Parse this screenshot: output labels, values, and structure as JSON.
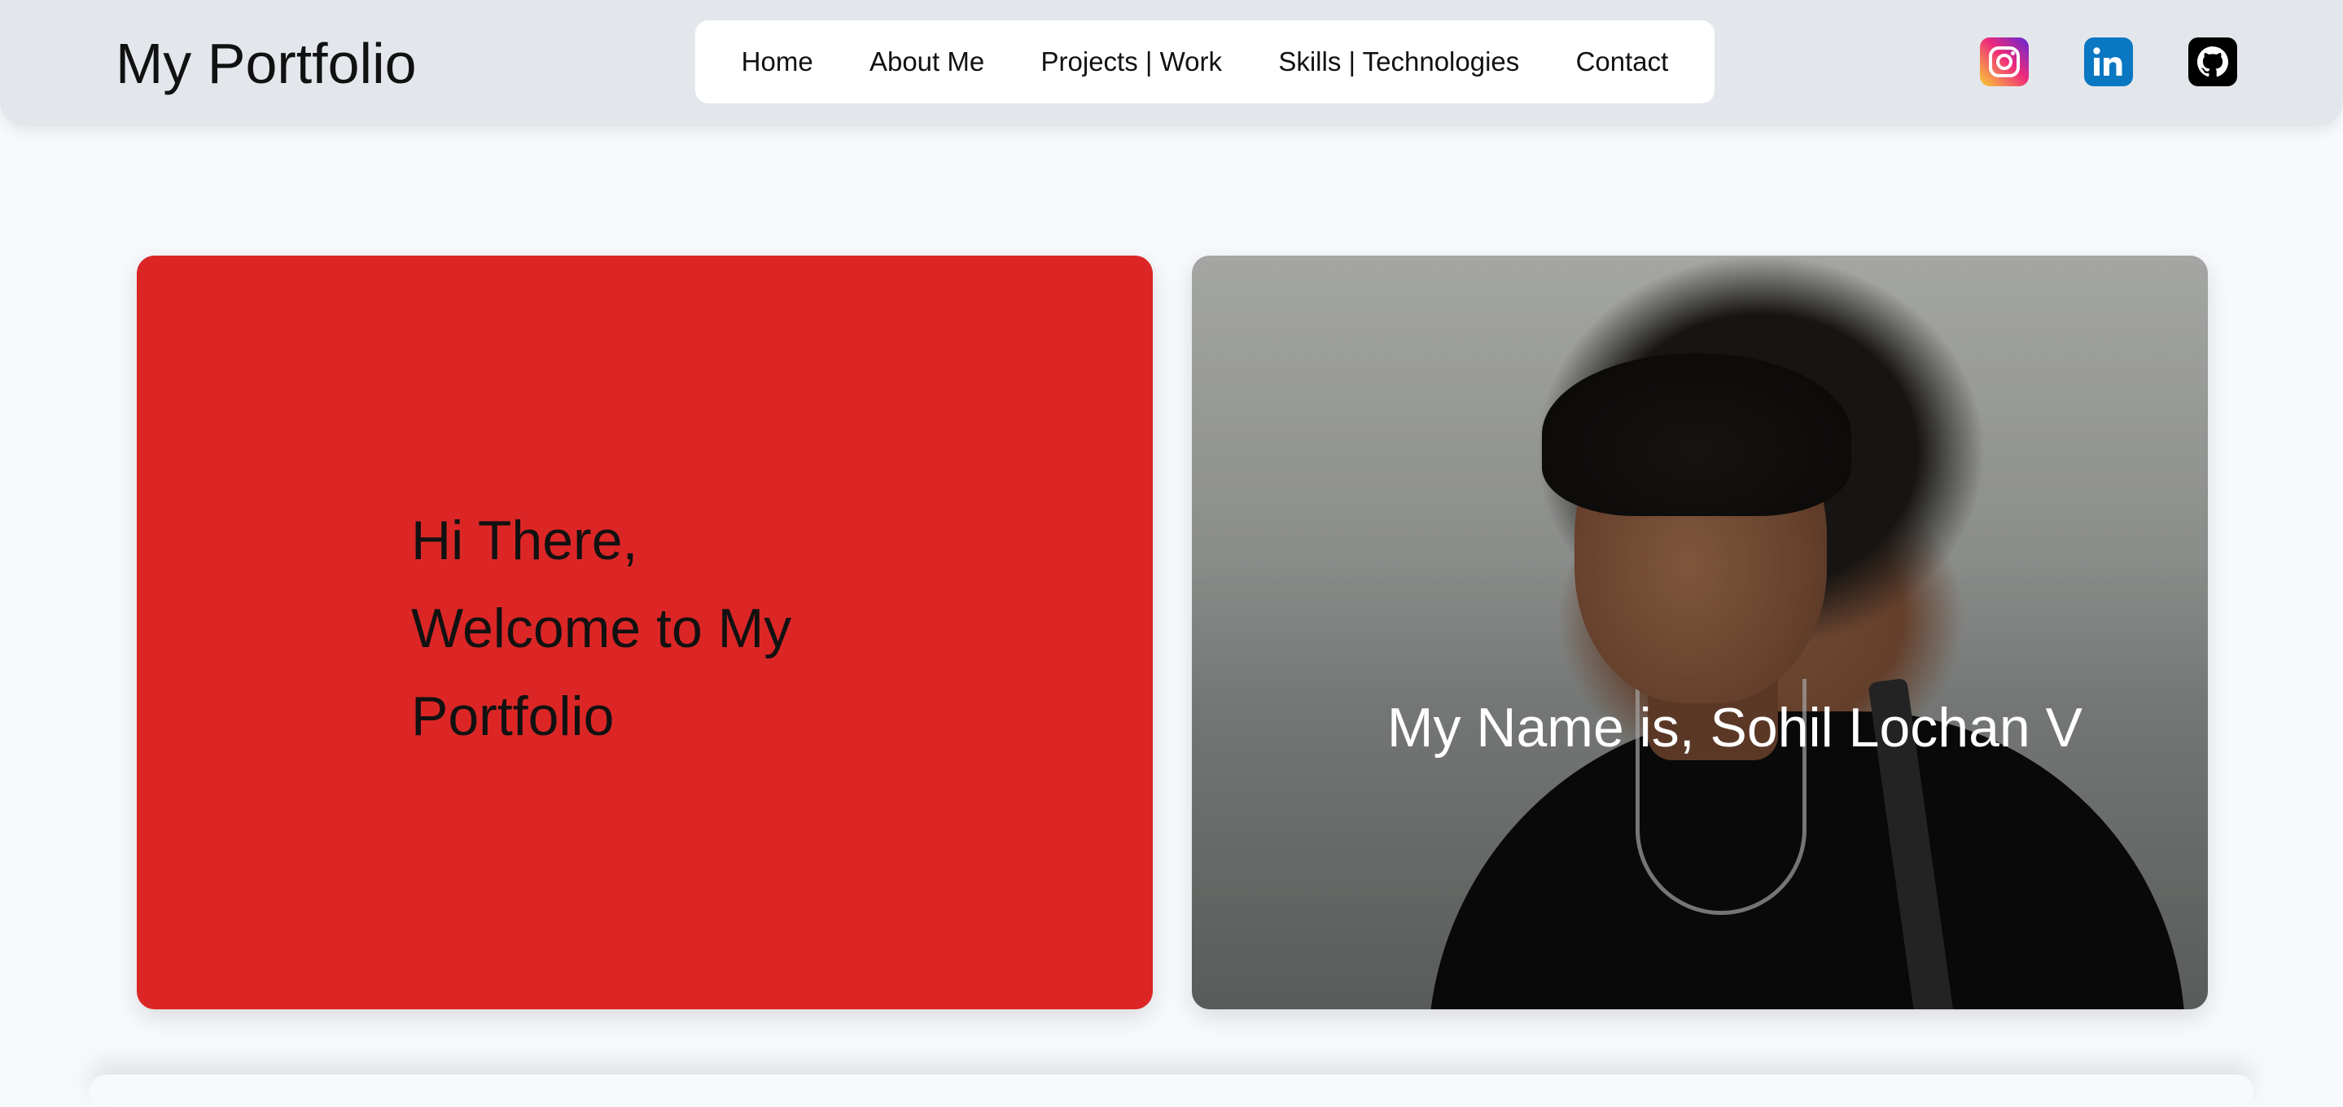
{
  "header": {
    "brand": "My Portfolio",
    "nav": [
      "Home",
      "About Me",
      "Projects | Work",
      "Skills | Technologies",
      "Contact"
    ],
    "social": [
      {
        "icon": "instagram-icon",
        "color": "#ee2a7b"
      },
      {
        "icon": "linkedin-icon",
        "color": "#0a77c2"
      },
      {
        "icon": "github-icon",
        "color": "#000000"
      }
    ]
  },
  "hero": {
    "welcome_line1": "Hi There,",
    "welcome_line2": "Welcome to My",
    "welcome_line3": "Portfolio",
    "name_caption": "My Name is, Sohil Lochan V",
    "accent": "#dc2626"
  }
}
